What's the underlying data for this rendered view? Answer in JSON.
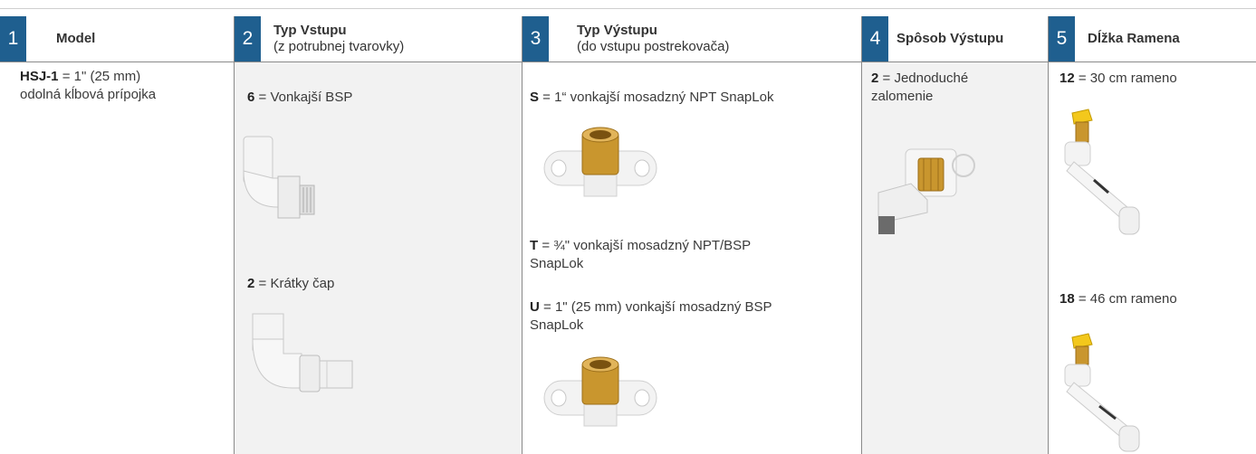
{
  "columns": [
    {
      "num": "1",
      "title": "Model",
      "subtitle": "",
      "items": [
        {
          "code": "HSJ-1",
          "text": " = 1\" (25 mm)\nodolná kĺbová  prípojka"
        }
      ]
    },
    {
      "num": "2",
      "title": "Typ Vstupu",
      "subtitle": "(z potrubnej tvarovky)",
      "items": [
        {
          "code": "6",
          "text": " = Vonkajší BSP"
        },
        {
          "code": "2",
          "text": " = Krátky čap"
        }
      ]
    },
    {
      "num": "3",
      "title": "Typ Výstupu",
      "subtitle": "(do vstupu postrekovača)",
      "items": [
        {
          "code": "S",
          "text": " = 1“ vonkajší mosadzný NPT SnapLok"
        },
        {
          "code": "T",
          "text": " = ¾\" vonkajší mosadzný NPT/BSP\nSnapLok"
        },
        {
          "code": "U",
          "text": " = 1\" (25 mm) vonkajší mosadzný BSP\nSnapLok"
        }
      ]
    },
    {
      "num": "4",
      "title": "Spôsob Výstupu",
      "subtitle": "",
      "items": [
        {
          "code": "2",
          "text": " = Jednoduché\nzalomenie"
        }
      ]
    },
    {
      "num": "5",
      "title": "Dĺžka Ramena",
      "subtitle": "",
      "items": [
        {
          "code": "12",
          "text": " = 30 cm rameno"
        },
        {
          "code": "18",
          "text": "  = 46 cm rameno"
        }
      ]
    }
  ],
  "colors": {
    "number_badge": "#1f5f8f",
    "shaded_column": "#f2f2f2",
    "brass": "#c9962e",
    "cap_yellow": "#f3c81c"
  }
}
